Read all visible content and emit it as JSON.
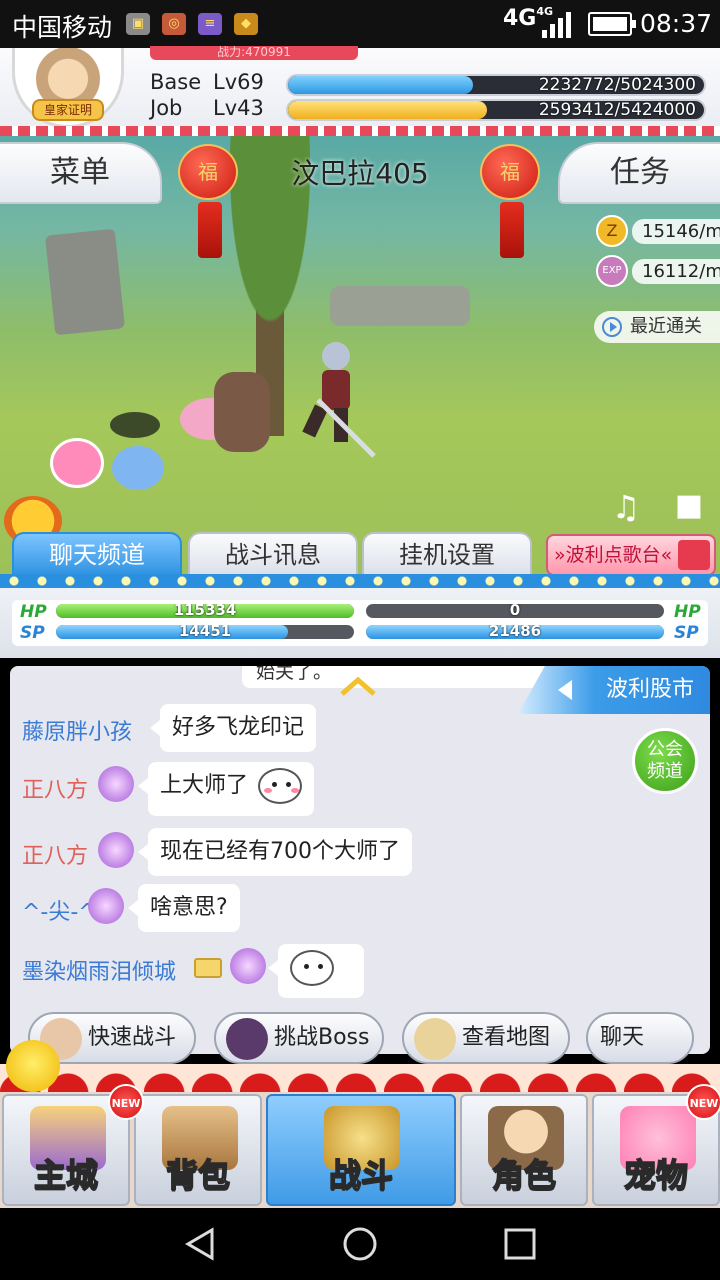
{
  "status_bar": {
    "carrier": "中国移动",
    "network": "4G",
    "network_small": "4G",
    "time": "08:37",
    "icons": [
      "image-icon",
      "app-icon",
      "notes-icon",
      "store-icon"
    ]
  },
  "header": {
    "power_text": "战力:470991",
    "avatar_badge": "皇家证明",
    "base": {
      "label": "Base",
      "level": "Lv69",
      "value_text": "2232772/5024300",
      "progress": 0.444
    },
    "job": {
      "label": "Job",
      "level": "Lv43",
      "value_text": "2593412/5424000",
      "progress": 0.478
    }
  },
  "game": {
    "menu_label": "菜单",
    "task_label": "任务",
    "map_name": "汶巴拉405",
    "lantern_text": "福",
    "zeny_rate": "15146/m",
    "exp_rate": "16112/m",
    "exp_icon_text": "EXP",
    "zeny_icon_text": "Z",
    "recent_label": "最近通关"
  },
  "tabs": {
    "items": [
      {
        "label": "聊天频道",
        "active": true
      },
      {
        "label": "战斗讯息",
        "active": false
      },
      {
        "label": "挂机设置",
        "active": false
      }
    ],
    "radio_label": "»波利点歌台«"
  },
  "vitals": {
    "hp_label": "HP",
    "sp_label": "SP",
    "player_hp": "115334",
    "player_sp": "14451",
    "player_hp_progress": 1.0,
    "player_sp_progress": 0.78,
    "target_hp": "0",
    "target_sp": "21486",
    "target_hp_progress": 0.0,
    "target_sp_progress": 1.0
  },
  "chat": {
    "top_message": "始关了。",
    "channel_name": "波利股市",
    "guild_button": "公会\n频道",
    "messages": [
      {
        "name": "藤原胖小孩",
        "text": "好多飞龙印记",
        "name_color": "#3a7bd5"
      },
      {
        "name": "正八方",
        "text": "上大师了",
        "name_color": "#e0605a"
      },
      {
        "name": "正八方",
        "text": "现在已经有700个大师了",
        "name_color": "#e0605a"
      },
      {
        "name": "^-尖-^",
        "text": "啥意思?",
        "name_color": "#3a7bd5"
      },
      {
        "name": "墨染烟雨泪倾城",
        "text": "",
        "name_color": "#3a7bd5"
      }
    ],
    "quick_actions": [
      "快速战斗",
      "挑战Boss",
      "查看地图",
      "聊天"
    ]
  },
  "nav": {
    "items": [
      {
        "label": "主城",
        "new": true,
        "active": false
      },
      {
        "label": "背包",
        "new": false,
        "active": false
      },
      {
        "label": "战斗",
        "new": false,
        "active": true
      },
      {
        "label": "角色",
        "new": false,
        "active": false
      },
      {
        "label": "宠物",
        "new": true,
        "active": false
      }
    ],
    "new_badge": "NEW"
  },
  "colors": {
    "accent_blue": "#2b8fe0",
    "hp_green": "#4fbd25",
    "festive_red": "#d81b1b"
  }
}
